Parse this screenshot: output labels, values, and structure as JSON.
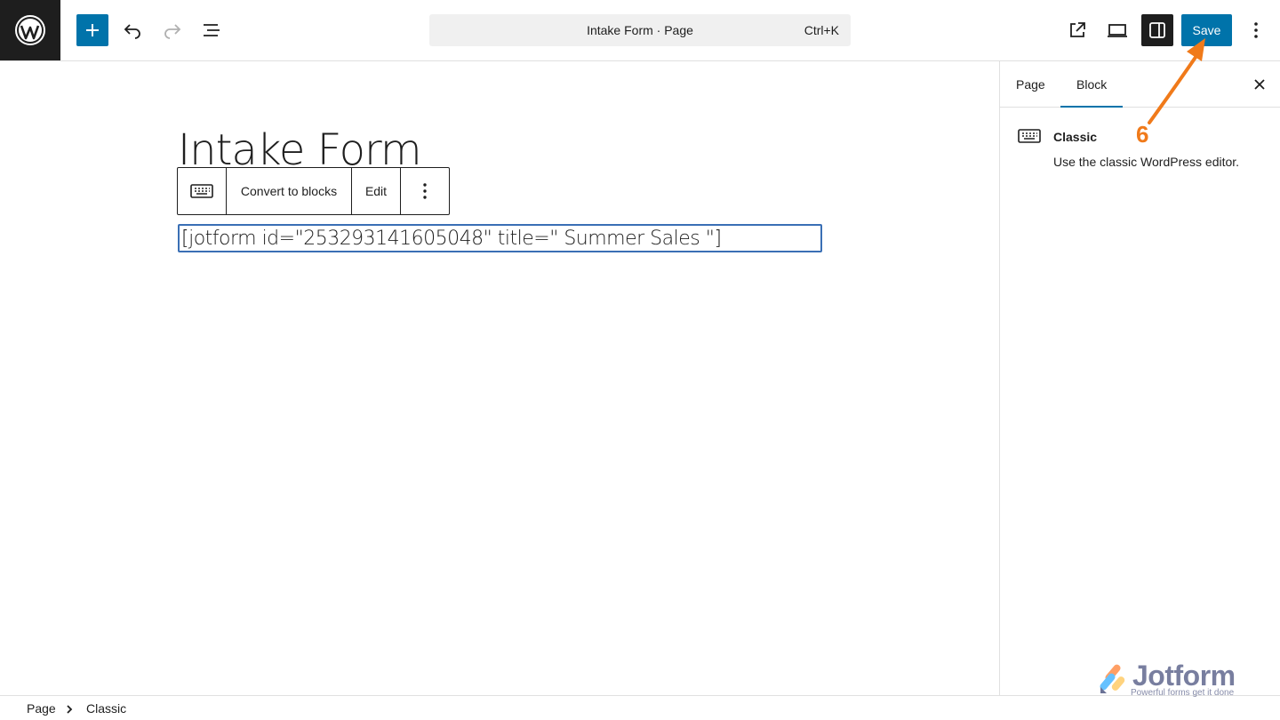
{
  "topbar": {
    "add_block_icon": "plus-icon",
    "undo_icon": "undo-icon",
    "redo_icon": "redo-icon",
    "document_overview_icon": "list-view-icon",
    "command": {
      "title": "Intake Form · Page",
      "shortcut": "Ctrl+K"
    },
    "view_page_icon": "external-link-icon",
    "preview_icon": "desktop-preview-icon",
    "settings_icon": "sidebar-toggle-icon",
    "save_label": "Save",
    "options_icon": "kebab-menu-icon"
  },
  "editor": {
    "page_title": "Intake Form",
    "block_toolbar": {
      "block_icon": "keyboard-icon",
      "convert_label": "Convert to blocks",
      "edit_label": "Edit",
      "more_icon": "vertical-ellipsis-icon"
    },
    "shortcode": "[jotform id=\"253293141605048\" title=\" Summer Sales \"]"
  },
  "sidebar": {
    "tabs": [
      {
        "label": "Page"
      },
      {
        "label": "Block"
      }
    ],
    "active_tab": "Block",
    "close_icon": "close-icon",
    "block_card": {
      "icon": "keyboard-icon",
      "title": "Classic",
      "description": "Use the classic WordPress editor."
    }
  },
  "breadcrumb": {
    "items": [
      "Page",
      "Classic"
    ]
  },
  "annotation": {
    "step": "6",
    "color": "#f07a1a"
  },
  "watermark": {
    "name": "Jotform",
    "tagline": "Powerful forms get it done"
  },
  "colors": {
    "accent": "#0073aa",
    "dark": "#1e1e1e"
  }
}
